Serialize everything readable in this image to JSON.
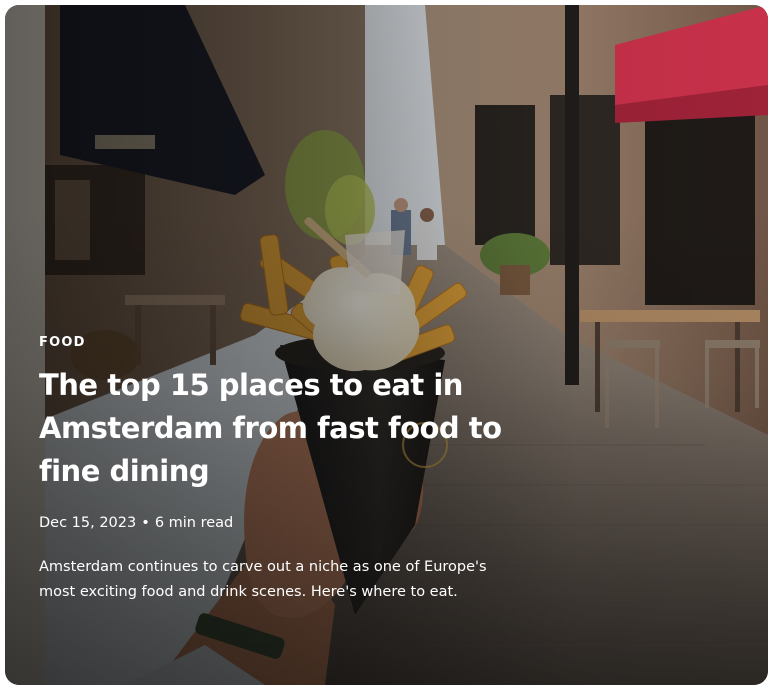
{
  "card": {
    "category": "FOOD",
    "title": "The top 15 places to eat in Amsterdam from fast food to fine dining",
    "date": "Dec 15, 2023",
    "separator": "•",
    "read_time": "6 min read",
    "description": "Amsterdam continues to carve out a niche as one of Europe's most exciting food and drink scenes. Here's where to eat."
  },
  "image": {
    "subject": "hand-holding-fries-cone-on-street"
  },
  "colors": {
    "text": "#ffffff",
    "awning_red": "#c8314a",
    "awning_dark": "#1c1f2a"
  }
}
